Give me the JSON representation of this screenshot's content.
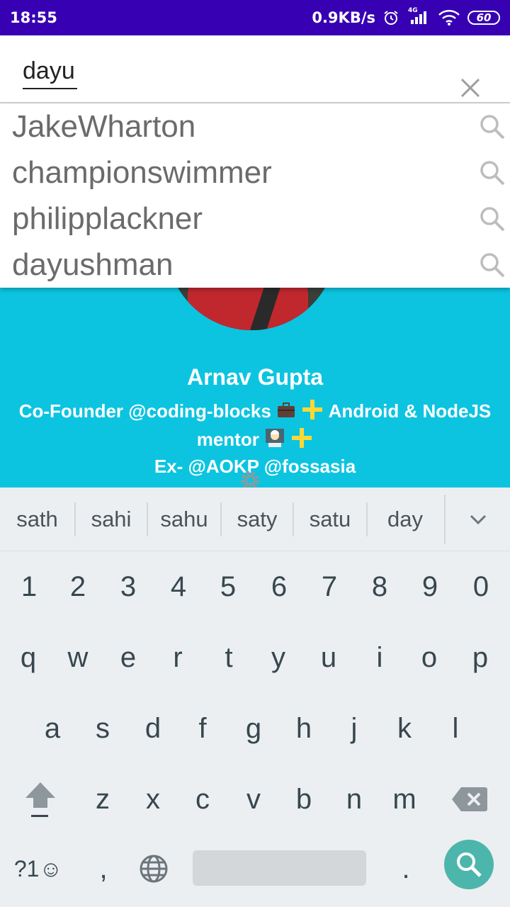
{
  "status_bar": {
    "time": "18:55",
    "network_speed": "0.9KB/s",
    "signal_label": "4G",
    "battery": "60"
  },
  "search": {
    "query": "dayu"
  },
  "suggestions": [
    {
      "label": "JakeWharton"
    },
    {
      "label": "championswimmer"
    },
    {
      "label": "philipplackner"
    },
    {
      "label": "dayushman"
    }
  ],
  "profile": {
    "name": "Arnav Gupta",
    "bio_line1_a": "Co-Founder @coding-blocks",
    "bio_line1_b": "Android & NodeJS",
    "bio_line2": "mentor",
    "bio_line3": "Ex- @AOKP @fossasia"
  },
  "keyboard": {
    "predictions": [
      "sath",
      "sahi",
      "sahu",
      "saty",
      "satu",
      "day"
    ],
    "number_row": [
      "1",
      "2",
      "3",
      "4",
      "5",
      "6",
      "7",
      "8",
      "9",
      "0"
    ],
    "row1": [
      "q",
      "w",
      "e",
      "r",
      "t",
      "y",
      "u",
      "i",
      "o",
      "p"
    ],
    "row2": [
      "a",
      "s",
      "d",
      "f",
      "g",
      "h",
      "j",
      "k",
      "l"
    ],
    "row3": [
      "z",
      "x",
      "c",
      "v",
      "b",
      "n",
      "m"
    ],
    "symbols_label": "?1☺",
    "comma": ",",
    "period": "."
  },
  "colors": {
    "status_bar": "#3700b3",
    "profile_background": "#0cc4e0",
    "search_key": "#4db6ac",
    "keyboard_background": "#eceff1"
  }
}
